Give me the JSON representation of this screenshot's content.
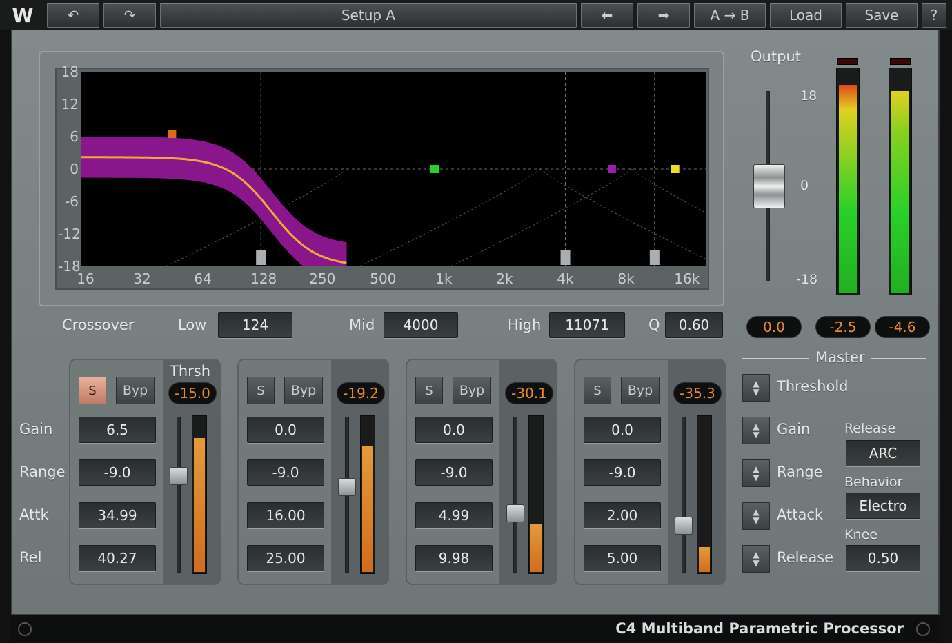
{
  "toolbar": {
    "logo": "W",
    "undo": "↶",
    "redo": "↷",
    "preset": "Setup A",
    "prev": "⬅",
    "next": "➡",
    "ab": "A → B",
    "load": "Load",
    "save": "Save",
    "help": "?"
  },
  "graph": {
    "y_ticks": [
      "18",
      "12",
      "6",
      "0",
      "-6",
      "-12",
      "-18"
    ],
    "x_ticks": [
      "16",
      "32",
      "64",
      "128",
      "250",
      "500",
      "1k",
      "2k",
      "4k",
      "8k",
      "16k"
    ],
    "node_colors": [
      "#e06a1a",
      "#2ad02a",
      "#a21ab0",
      "#e8e020"
    ],
    "band_color": "#8a168c",
    "curve_color": "#f0a83a"
  },
  "crossover": {
    "label": "Crossover",
    "low_label": "Low",
    "low": "124",
    "mid_label": "Mid",
    "mid": "4000",
    "high_label": "High",
    "high": "11071",
    "q_label": "Q",
    "q": "0.60"
  },
  "row_labels": {
    "gain": "Gain",
    "range": "Range",
    "attack": "Attk",
    "release": "Rel"
  },
  "thresh_label": "Thrsh",
  "bands": [
    {
      "solo": "S",
      "bypass": "Byp",
      "thresh": "-15.0",
      "gain": "6.5",
      "range": "-9.0",
      "attack": "34.99",
      "release": "40.27",
      "thresh_level": 0.62,
      "meter_level": 0.86
    },
    {
      "solo": "S",
      "bypass": "Byp",
      "thresh": "-19.2",
      "gain": "0.0",
      "range": "-9.0",
      "attack": "16.00",
      "release": "25.00",
      "thresh_level": 0.55,
      "meter_level": 0.81
    },
    {
      "solo": "S",
      "bypass": "Byp",
      "thresh": "-30.1",
      "gain": "0.0",
      "range": "-9.0",
      "attack": "4.99",
      "release": "9.98",
      "thresh_level": 0.38,
      "meter_level": 0.31
    },
    {
      "solo": "S",
      "bypass": "Byp",
      "thresh": "-35.3",
      "gain": "0.0",
      "range": "-9.0",
      "attack": "2.00",
      "release": "5.00",
      "thresh_level": 0.3,
      "meter_level": 0.16
    }
  ],
  "output": {
    "label": "Output",
    "scale": [
      "18",
      "0",
      "-18"
    ],
    "fader_value": "0.0",
    "meter_left": "-2.5",
    "meter_right": "-4.6",
    "meter_left_level": 0.93,
    "meter_right_level": 0.9
  },
  "master": {
    "title": "Master",
    "threshold": "Threshold",
    "gain": "Gain",
    "range": "Range",
    "attack": "Attack",
    "release": "Release",
    "release_mode_label": "Release",
    "release_mode": "ARC",
    "behavior_label": "Behavior",
    "behavior": "Electro",
    "knee_label": "Knee",
    "knee": "0.50"
  },
  "footer": {
    "title": "C4 Multiband Parametric Processor"
  }
}
